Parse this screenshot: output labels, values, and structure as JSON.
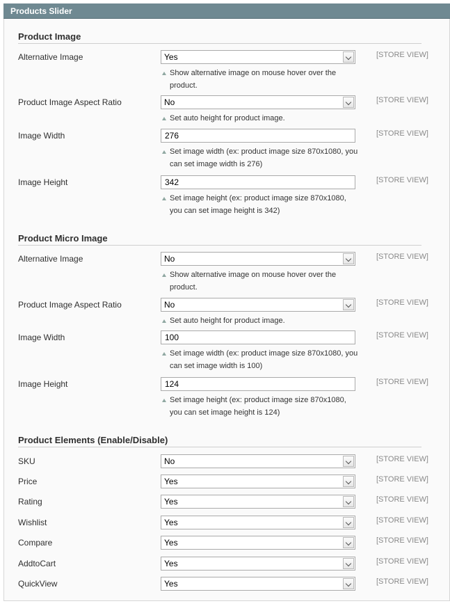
{
  "panel": {
    "title": "Products Slider"
  },
  "scope_label": "[STORE VIEW]",
  "sections": {
    "product_image": {
      "title": "Product Image",
      "fields": {
        "alt_image": {
          "label": "Alternative Image",
          "value": "Yes",
          "note_line1": "Show alternative image on mouse hover over the",
          "note_line2": "product."
        },
        "aspect_ratio": {
          "label": "Product Image Aspect Ratio",
          "value": "No",
          "note_line1": "Set auto height for product image."
        },
        "width": {
          "label": "Image Width",
          "value": "276",
          "note_line1": "Set image width (ex: product image size 870x1080, you",
          "note_line2": "can set image width is 276)"
        },
        "height": {
          "label": "Image Height",
          "value": "342",
          "note_line1": "Set image height (ex: product image size 870x1080,",
          "note_line2": "you can set image height is 342)"
        }
      }
    },
    "product_micro_image": {
      "title": "Product Micro Image",
      "fields": {
        "alt_image": {
          "label": "Alternative Image",
          "value": "No",
          "note_line1": "Show alternative image on mouse hover over the",
          "note_line2": "product."
        },
        "aspect_ratio": {
          "label": "Product Image Aspect Ratio",
          "value": "No",
          "note_line1": "Set auto height for product image."
        },
        "width": {
          "label": "Image Width",
          "value": "100",
          "note_line1": "Set image width (ex: product image size 870x1080, you",
          "note_line2": "can set image width is 100)"
        },
        "height": {
          "label": "Image Height",
          "value": "124",
          "note_line1": "Set image height (ex: product image size 870x1080,",
          "note_line2": "you can set image height is 124)"
        }
      }
    },
    "product_elements": {
      "title": "Product Elements (Enable/Disable)",
      "fields": {
        "sku": {
          "label": "SKU",
          "value": "No"
        },
        "price": {
          "label": "Price",
          "value": "Yes"
        },
        "rating": {
          "label": "Rating",
          "value": "Yes"
        },
        "wishlist": {
          "label": "Wishlist",
          "value": "Yes"
        },
        "compare": {
          "label": "Compare",
          "value": "Yes"
        },
        "addtocart": {
          "label": "AddtoCart",
          "value": "Yes"
        },
        "quickview": {
          "label": "QuickView",
          "value": "Yes"
        }
      }
    }
  }
}
